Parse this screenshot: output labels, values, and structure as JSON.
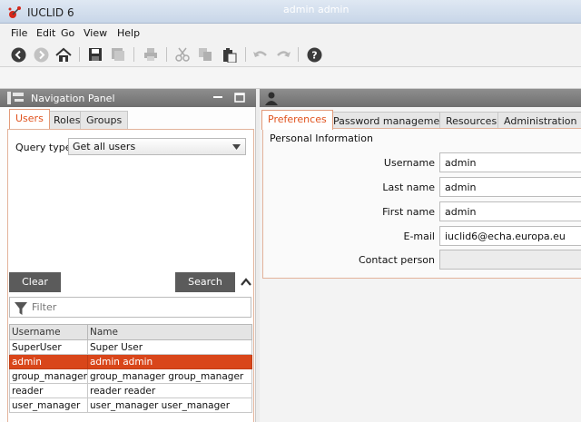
{
  "window": {
    "title": "IUCLID 6"
  },
  "menu": [
    "File",
    "Edit",
    "Go",
    "View",
    "Help"
  ],
  "nav_panel": {
    "title": "Navigation Panel",
    "tabs": [
      "Users",
      "Roles",
      "Groups"
    ],
    "query_type_label": "Query type",
    "query_type_value": "Get all users",
    "clear_label": "Clear",
    "search_label": "Search",
    "filter_placeholder": "Filter",
    "table": {
      "columns": [
        "Username",
        "Name"
      ],
      "rows": [
        {
          "username": "SuperUser",
          "name": "Super User"
        },
        {
          "username": "admin",
          "name": "admin admin"
        },
        {
          "username": "group_manager",
          "name": "group_manager group_manager"
        },
        {
          "username": "reader",
          "name": "reader reader"
        },
        {
          "username": "user_manager",
          "name": "user_manager user_manager"
        }
      ]
    }
  },
  "user_panel": {
    "title": "admin admin",
    "tabs": [
      "Preferences",
      "Password management",
      "Resources",
      "Administration"
    ],
    "section_title": "Personal Information",
    "fields": [
      {
        "label": "Username",
        "value": "admin"
      },
      {
        "label": "Last name",
        "value": "admin"
      },
      {
        "label": "First name",
        "value": "admin"
      },
      {
        "label": "E-mail",
        "value": "iuclid6@echa.europa.eu"
      },
      {
        "label": "Contact person",
        "value": ""
      }
    ]
  },
  "colors": {
    "accent": "#e0521d",
    "selection": "#d9461a",
    "header": "#7a7a7a"
  }
}
